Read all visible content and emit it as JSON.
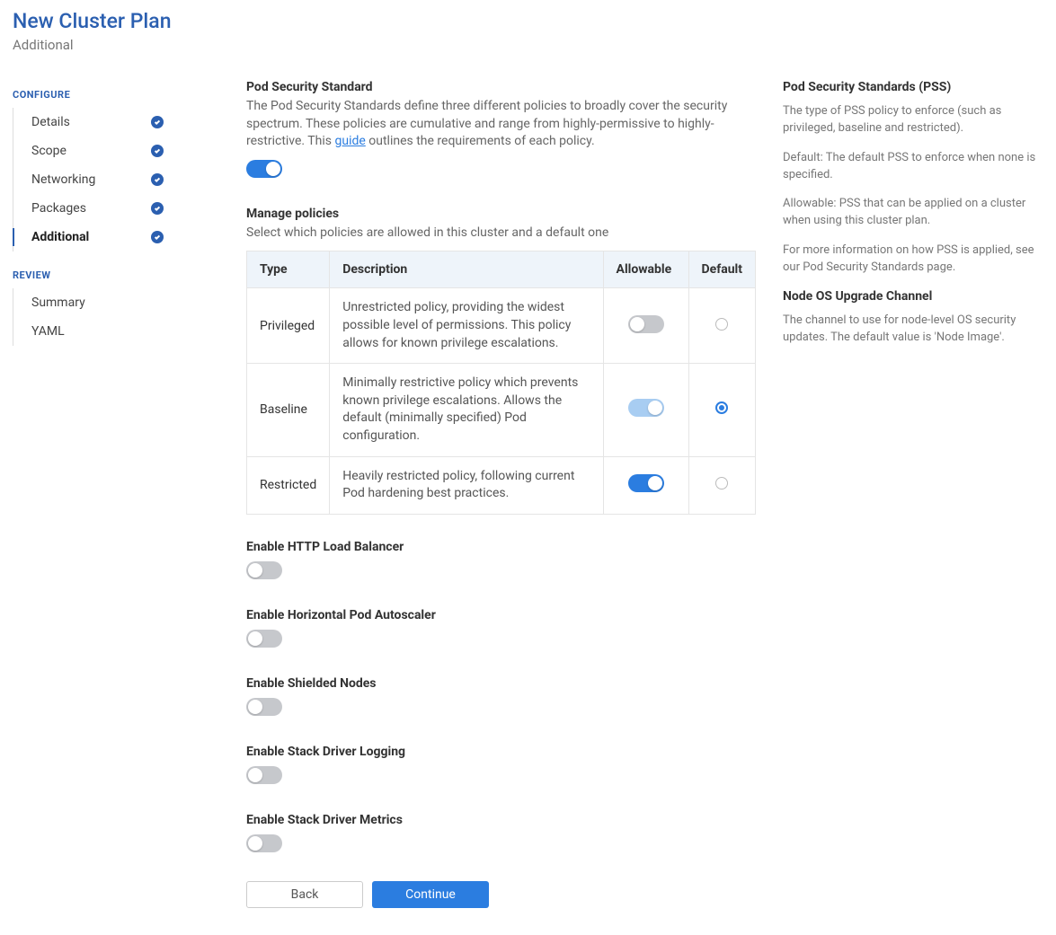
{
  "header": {
    "title": "New Cluster Plan",
    "subtitle": "Additional"
  },
  "sidebar": {
    "configure_label": "CONFIGURE",
    "review_label": "REVIEW",
    "configure_items": [
      {
        "label": "Details",
        "checked": true,
        "active": false
      },
      {
        "label": "Scope",
        "checked": true,
        "active": false
      },
      {
        "label": "Networking",
        "checked": true,
        "active": false
      },
      {
        "label": "Packages",
        "checked": true,
        "active": false
      },
      {
        "label": "Additional",
        "checked": true,
        "active": true
      }
    ],
    "review_items": [
      {
        "label": "Summary"
      },
      {
        "label": "YAML"
      }
    ]
  },
  "pss": {
    "title": "Pod Security Standard",
    "desc_before": "The Pod Security Standards define three different policies to broadly cover the security spectrum. These policies are cumulative and range from highly-permissive to highly-restrictive. This ",
    "link_text": "guide",
    "desc_after": " outlines the requirements of each policy.",
    "enabled": true
  },
  "manage": {
    "title": "Manage policies",
    "desc": "Select which policies are allowed in this cluster and a default one",
    "headers": {
      "type": "Type",
      "description": "Description",
      "allowable": "Allowable",
      "default": "Default"
    },
    "rows": [
      {
        "type": "Privileged",
        "description": "Unrestricted policy, providing the widest possible level of permissions. This policy allows for known privilege escalations.",
        "allowable": false,
        "locked": false,
        "default": false
      },
      {
        "type": "Baseline",
        "description": "Minimally restrictive policy which prevents known privilege escalations. Allows the default (minimally specified) Pod configuration.",
        "allowable": true,
        "locked": true,
        "default": true
      },
      {
        "type": "Restricted",
        "description": "Heavily restricted policy, following current Pod hardening best practices.",
        "allowable": true,
        "locked": false,
        "default": false
      }
    ]
  },
  "toggles": [
    {
      "key": "http_lb",
      "label": "Enable HTTP Load Balancer",
      "on": false
    },
    {
      "key": "hpa",
      "label": "Enable Horizontal Pod Autoscaler",
      "on": false
    },
    {
      "key": "shielded",
      "label": "Enable Shielded Nodes",
      "on": false
    },
    {
      "key": "sd_logging",
      "label": "Enable Stack Driver Logging",
      "on": false
    },
    {
      "key": "sd_metrics",
      "label": "Enable Stack Driver Metrics",
      "on": false
    }
  ],
  "buttons": {
    "back": "Back",
    "continue": "Continue"
  },
  "info": {
    "pss_title": "Pod Security Standards (PSS)",
    "pss_p1": "The type of PSS policy to enforce (such as privileged, baseline and restricted).",
    "pss_p2": "Default: The default PSS to enforce when none is specified.",
    "pss_p3": "Allowable: PSS that can be applied on a cluster when using this cluster plan.",
    "pss_p4": "For more information on how PSS is applied, see our Pod Security Standards page.",
    "node_title": "Node OS Upgrade Channel",
    "node_p1": "The channel to use for node-level OS security updates. The default value is 'Node Image'."
  }
}
